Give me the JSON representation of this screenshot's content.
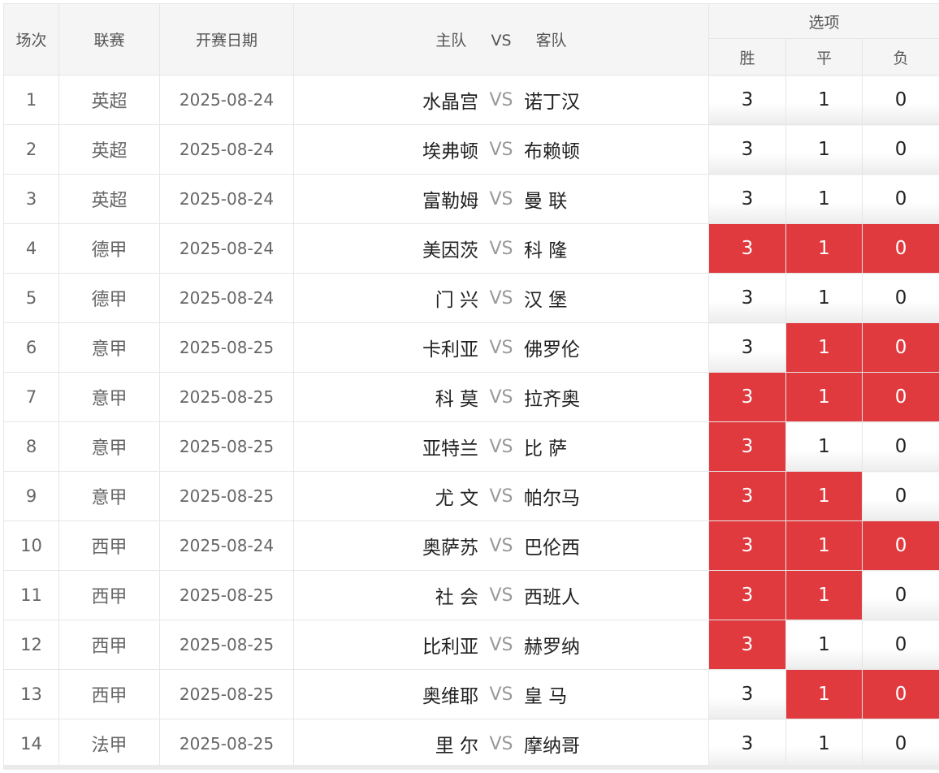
{
  "header": {
    "col_no": "场次",
    "col_league": "联赛",
    "col_date": "开赛日期",
    "col_match_home": "主队",
    "col_match_vs": "VS",
    "col_match_away": "客队",
    "col_options": "选项",
    "opt_win": "胜",
    "opt_draw": "平",
    "opt_loss": "负"
  },
  "colors": {
    "selected": "#e03a3e",
    "vs": "#999999"
  },
  "rows": [
    {
      "no": "1",
      "league": "英超",
      "date": "2025-08-24",
      "home": "水晶宫",
      "vs": "VS",
      "away": "诺丁汉",
      "win": "3",
      "draw": "1",
      "loss": "0",
      "sel": [
        false,
        false,
        false
      ]
    },
    {
      "no": "2",
      "league": "英超",
      "date": "2025-08-24",
      "home": "埃弗顿",
      "vs": "VS",
      "away": "布赖顿",
      "win": "3",
      "draw": "1",
      "loss": "0",
      "sel": [
        false,
        false,
        false
      ]
    },
    {
      "no": "3",
      "league": "英超",
      "date": "2025-08-24",
      "home": "富勒姆",
      "vs": "VS",
      "away": "曼 联",
      "win": "3",
      "draw": "1",
      "loss": "0",
      "sel": [
        false,
        false,
        false
      ]
    },
    {
      "no": "4",
      "league": "德甲",
      "date": "2025-08-24",
      "home": "美因茨",
      "vs": "VS",
      "away": "科 隆",
      "win": "3",
      "draw": "1",
      "loss": "0",
      "sel": [
        true,
        true,
        true
      ]
    },
    {
      "no": "5",
      "league": "德甲",
      "date": "2025-08-24",
      "home": "门 兴",
      "vs": "VS",
      "away": "汉 堡",
      "win": "3",
      "draw": "1",
      "loss": "0",
      "sel": [
        false,
        false,
        false
      ]
    },
    {
      "no": "6",
      "league": "意甲",
      "date": "2025-08-25",
      "home": "卡利亚",
      "vs": "VS",
      "away": "佛罗伦",
      "win": "3",
      "draw": "1",
      "loss": "0",
      "sel": [
        false,
        true,
        true
      ]
    },
    {
      "no": "7",
      "league": "意甲",
      "date": "2025-08-25",
      "home": "科 莫",
      "vs": "VS",
      "away": "拉齐奥",
      "win": "3",
      "draw": "1",
      "loss": "0",
      "sel": [
        true,
        true,
        true
      ]
    },
    {
      "no": "8",
      "league": "意甲",
      "date": "2025-08-25",
      "home": "亚特兰",
      "vs": "VS",
      "away": "比 萨",
      "win": "3",
      "draw": "1",
      "loss": "0",
      "sel": [
        true,
        false,
        false
      ]
    },
    {
      "no": "9",
      "league": "意甲",
      "date": "2025-08-25",
      "home": "尤 文",
      "vs": "VS",
      "away": "帕尔马",
      "win": "3",
      "draw": "1",
      "loss": "0",
      "sel": [
        true,
        true,
        false
      ]
    },
    {
      "no": "10",
      "league": "西甲",
      "date": "2025-08-24",
      "home": "奥萨苏",
      "vs": "VS",
      "away": "巴伦西",
      "win": "3",
      "draw": "1",
      "loss": "0",
      "sel": [
        true,
        true,
        true
      ]
    },
    {
      "no": "11",
      "league": "西甲",
      "date": "2025-08-25",
      "home": "社 会",
      "vs": "VS",
      "away": "西班人",
      "win": "3",
      "draw": "1",
      "loss": "0",
      "sel": [
        true,
        true,
        false
      ]
    },
    {
      "no": "12",
      "league": "西甲",
      "date": "2025-08-25",
      "home": "比利亚",
      "vs": "VS",
      "away": "赫罗纳",
      "win": "3",
      "draw": "1",
      "loss": "0",
      "sel": [
        true,
        false,
        false
      ]
    },
    {
      "no": "13",
      "league": "西甲",
      "date": "2025-08-25",
      "home": "奥维耶",
      "vs": "VS",
      "away": "皇 马",
      "win": "3",
      "draw": "1",
      "loss": "0",
      "sel": [
        false,
        true,
        true
      ]
    },
    {
      "no": "14",
      "league": "法甲",
      "date": "2025-08-25",
      "home": "里 尔",
      "vs": "VS",
      "away": "摩纳哥",
      "win": "3",
      "draw": "1",
      "loss": "0",
      "sel": [
        false,
        false,
        false
      ]
    }
  ]
}
